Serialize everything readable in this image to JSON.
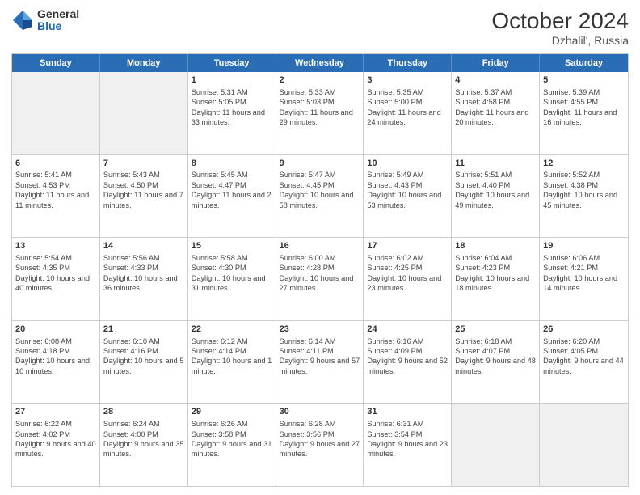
{
  "header": {
    "logo_general": "General",
    "logo_blue": "Blue",
    "month": "October 2024",
    "location": "Dzhalil', Russia"
  },
  "days_of_week": [
    "Sunday",
    "Monday",
    "Tuesday",
    "Wednesday",
    "Thursday",
    "Friday",
    "Saturday"
  ],
  "rows": [
    [
      {
        "day": "",
        "text": "",
        "shade": true
      },
      {
        "day": "",
        "text": "",
        "shade": true
      },
      {
        "day": "1",
        "text": "Sunrise: 5:31 AM\nSunset: 5:05 PM\nDaylight: 11 hours and 33 minutes."
      },
      {
        "day": "2",
        "text": "Sunrise: 5:33 AM\nSunset: 5:03 PM\nDaylight: 11 hours and 29 minutes."
      },
      {
        "day": "3",
        "text": "Sunrise: 5:35 AM\nSunset: 5:00 PM\nDaylight: 11 hours and 24 minutes."
      },
      {
        "day": "4",
        "text": "Sunrise: 5:37 AM\nSunset: 4:58 PM\nDaylight: 11 hours and 20 minutes."
      },
      {
        "day": "5",
        "text": "Sunrise: 5:39 AM\nSunset: 4:55 PM\nDaylight: 11 hours and 16 minutes.",
        "shade": false
      }
    ],
    [
      {
        "day": "6",
        "text": "Sunrise: 5:41 AM\nSunset: 4:53 PM\nDaylight: 11 hours and 11 minutes."
      },
      {
        "day": "7",
        "text": "Sunrise: 5:43 AM\nSunset: 4:50 PM\nDaylight: 11 hours and 7 minutes."
      },
      {
        "day": "8",
        "text": "Sunrise: 5:45 AM\nSunset: 4:47 PM\nDaylight: 11 hours and 2 minutes."
      },
      {
        "day": "9",
        "text": "Sunrise: 5:47 AM\nSunset: 4:45 PM\nDaylight: 10 hours and 58 minutes."
      },
      {
        "day": "10",
        "text": "Sunrise: 5:49 AM\nSunset: 4:43 PM\nDaylight: 10 hours and 53 minutes."
      },
      {
        "day": "11",
        "text": "Sunrise: 5:51 AM\nSunset: 4:40 PM\nDaylight: 10 hours and 49 minutes."
      },
      {
        "day": "12",
        "text": "Sunrise: 5:52 AM\nSunset: 4:38 PM\nDaylight: 10 hours and 45 minutes."
      }
    ],
    [
      {
        "day": "13",
        "text": "Sunrise: 5:54 AM\nSunset: 4:35 PM\nDaylight: 10 hours and 40 minutes."
      },
      {
        "day": "14",
        "text": "Sunrise: 5:56 AM\nSunset: 4:33 PM\nDaylight: 10 hours and 36 minutes."
      },
      {
        "day": "15",
        "text": "Sunrise: 5:58 AM\nSunset: 4:30 PM\nDaylight: 10 hours and 31 minutes."
      },
      {
        "day": "16",
        "text": "Sunrise: 6:00 AM\nSunset: 4:28 PM\nDaylight: 10 hours and 27 minutes."
      },
      {
        "day": "17",
        "text": "Sunrise: 6:02 AM\nSunset: 4:25 PM\nDaylight: 10 hours and 23 minutes."
      },
      {
        "day": "18",
        "text": "Sunrise: 6:04 AM\nSunset: 4:23 PM\nDaylight: 10 hours and 18 minutes."
      },
      {
        "day": "19",
        "text": "Sunrise: 6:06 AM\nSunset: 4:21 PM\nDaylight: 10 hours and 14 minutes."
      }
    ],
    [
      {
        "day": "20",
        "text": "Sunrise: 6:08 AM\nSunset: 4:18 PM\nDaylight: 10 hours and 10 minutes."
      },
      {
        "day": "21",
        "text": "Sunrise: 6:10 AM\nSunset: 4:16 PM\nDaylight: 10 hours and 5 minutes."
      },
      {
        "day": "22",
        "text": "Sunrise: 6:12 AM\nSunset: 4:14 PM\nDaylight: 10 hours and 1 minute."
      },
      {
        "day": "23",
        "text": "Sunrise: 6:14 AM\nSunset: 4:11 PM\nDaylight: 9 hours and 57 minutes."
      },
      {
        "day": "24",
        "text": "Sunrise: 6:16 AM\nSunset: 4:09 PM\nDaylight: 9 hours and 52 minutes."
      },
      {
        "day": "25",
        "text": "Sunrise: 6:18 AM\nSunset: 4:07 PM\nDaylight: 9 hours and 48 minutes."
      },
      {
        "day": "26",
        "text": "Sunrise: 6:20 AM\nSunset: 4:05 PM\nDaylight: 9 hours and 44 minutes."
      }
    ],
    [
      {
        "day": "27",
        "text": "Sunrise: 6:22 AM\nSunset: 4:02 PM\nDaylight: 9 hours and 40 minutes."
      },
      {
        "day": "28",
        "text": "Sunrise: 6:24 AM\nSunset: 4:00 PM\nDaylight: 9 hours and 35 minutes."
      },
      {
        "day": "29",
        "text": "Sunrise: 6:26 AM\nSunset: 3:58 PM\nDaylight: 9 hours and 31 minutes."
      },
      {
        "day": "30",
        "text": "Sunrise: 6:28 AM\nSunset: 3:56 PM\nDaylight: 9 hours and 27 minutes."
      },
      {
        "day": "31",
        "text": "Sunrise: 6:31 AM\nSunset: 3:54 PM\nDaylight: 9 hours and 23 minutes."
      },
      {
        "day": "",
        "text": "",
        "shade": true
      },
      {
        "day": "",
        "text": "",
        "shade": true
      }
    ]
  ]
}
